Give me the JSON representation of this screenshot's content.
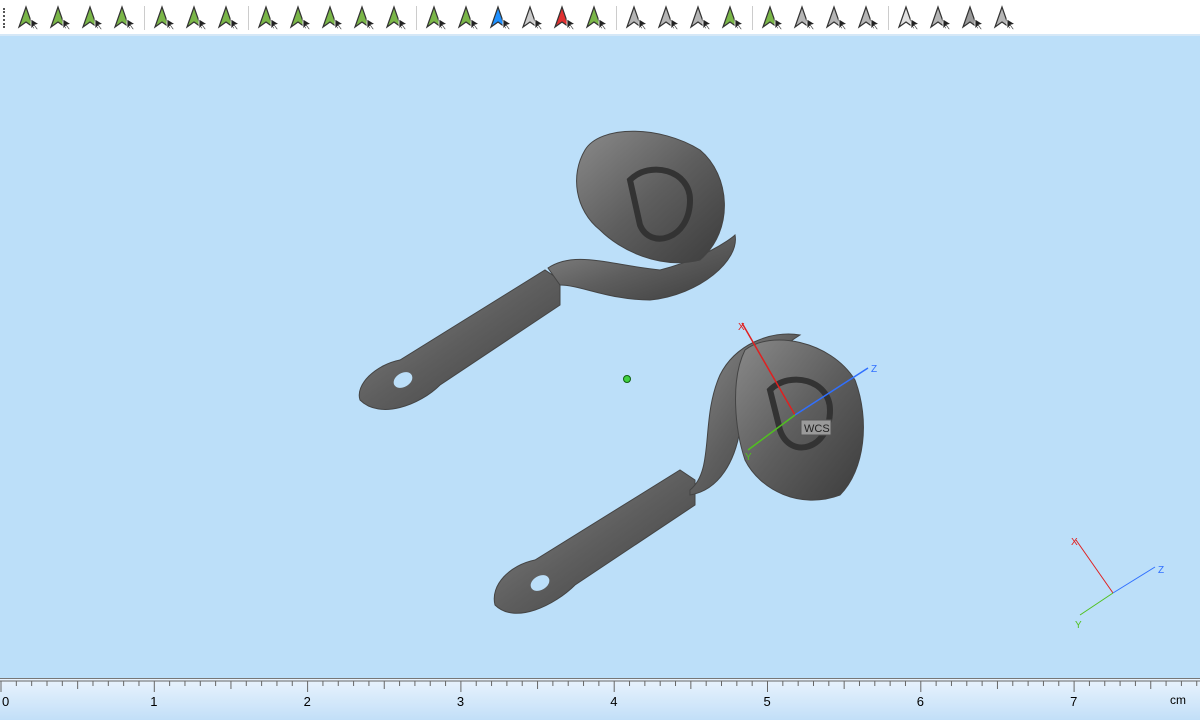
{
  "toolbar": {
    "groups": [
      [
        {
          "name": "select-point-icon",
          "color": "#7ab648"
        },
        {
          "name": "select-face-icon",
          "color": "#7ab648"
        },
        {
          "name": "select-surface-icon",
          "color": "#7ab648"
        },
        {
          "name": "select-shell-icon",
          "color": "#7ab648"
        }
      ],
      [
        {
          "name": "rectangle-select-icon",
          "color": "#7ab648"
        },
        {
          "name": "lasso-select-icon",
          "color": "#7ab648"
        },
        {
          "name": "curve-select-icon",
          "color": "#7ab648"
        }
      ],
      [
        {
          "name": "triangle-select-icon",
          "color": "#7ab648"
        },
        {
          "name": "split-select-icon",
          "color": "#7ab648"
        },
        {
          "name": "star-select-icon",
          "color": "#7ab648"
        },
        {
          "name": "wheel-select-icon",
          "color": "#7ab648"
        },
        {
          "name": "ellipse-select-icon",
          "color": "#7ab648"
        }
      ],
      [
        {
          "name": "cube-select-icon",
          "color": "#7ab648"
        },
        {
          "name": "cube-select-white-icon",
          "color": "#7ab648"
        },
        {
          "name": "cube-select-color-icon",
          "color": "#1e90ff"
        },
        {
          "name": "cube-select-disabled-icon",
          "color": "#cccccc"
        },
        {
          "name": "cube-marker-icon",
          "color": "#e03030"
        },
        {
          "name": "cube-edit-icon",
          "color": "#7ab648"
        }
      ],
      [
        {
          "name": "select-gray-icon",
          "color": "#b5b5b5"
        },
        {
          "name": "shrink-selection-icon",
          "color": "#b5b5b5"
        },
        {
          "name": "grow-selection-icon",
          "color": "#b5b5b5"
        },
        {
          "name": "invert-selection-icon",
          "color": "#7ab648"
        }
      ],
      [
        {
          "name": "clear-selection-icon",
          "color": "#7ab648"
        },
        {
          "name": "copy-selection-icon",
          "color": "#b5b5b5"
        },
        {
          "name": "paste-selection-icon",
          "color": "#b5b5b5"
        },
        {
          "name": "split-plane-icon",
          "color": "#b5b5b5"
        }
      ],
      [
        {
          "name": "hide-icon",
          "color": "#e0e0e0"
        },
        {
          "name": "swap-visibility-icon",
          "color": "#b5b5b5"
        },
        {
          "name": "show-icon",
          "color": "#9a9a9a"
        },
        {
          "name": "show-all-icon",
          "color": "#b5b5b5"
        }
      ]
    ]
  },
  "viewport": {
    "wcs_label": "WCS",
    "axes": {
      "x": "X",
      "y": "Y",
      "z": "Z"
    },
    "colors": {
      "x": "#e02020",
      "y": "#50c020",
      "z": "#3070ff"
    }
  },
  "ruler": {
    "labels": [
      "0",
      "1",
      "2",
      "3",
      "4",
      "5",
      "6",
      "7"
    ],
    "unit": "cm"
  }
}
